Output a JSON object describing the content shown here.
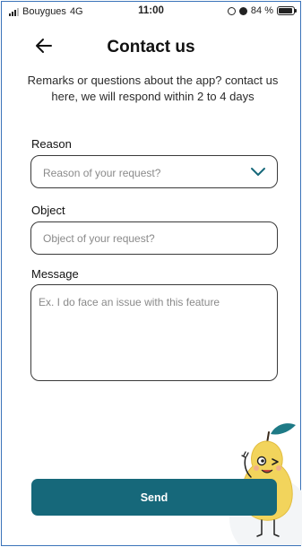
{
  "status_bar": {
    "carrier": "Bouygues",
    "network": "4G",
    "time": "11:00",
    "battery": "84 %",
    "battery_level": 0.84
  },
  "header": {
    "title": "Contact us",
    "subtitle": "Remarks or questions about the app? contact us here, we will respond within 2 to 4 days"
  },
  "form": {
    "reason": {
      "label": "Reason",
      "placeholder": "Reason of your request?"
    },
    "object": {
      "label": "Object",
      "placeholder": "Object of your request?"
    },
    "message": {
      "label": "Message",
      "placeholder": "Ex. I do face an issue with this feature"
    }
  },
  "actions": {
    "send_label": "Send"
  },
  "colors": {
    "primary": "#16687a",
    "border": "#3a3a3a",
    "mascot_body": "#f2d45c",
    "mascot_leaf": "#1e7a86"
  },
  "icons": {
    "back": "arrow-left-icon",
    "dropdown": "chevron-down-icon",
    "mascot": "pear-mascot"
  }
}
